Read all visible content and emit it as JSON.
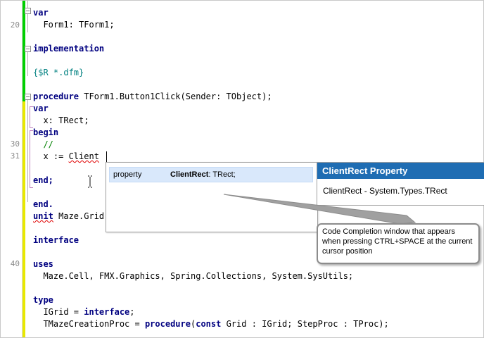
{
  "editor": {
    "line_numbers": [
      {
        "label": "20"
      },
      {
        "label": "30"
      },
      {
        "label": "31"
      },
      {
        "label": "40"
      }
    ],
    "lines": [
      {
        "text": "var"
      },
      {
        "text": "  Form1: TForm1;"
      },
      {
        "text": "implementation"
      },
      {
        "text": "{$R *.dfm}"
      },
      {
        "p1": "procedure",
        "p2": " TForm1.Button1Click(Sender: TObject);"
      },
      {
        "text": "var"
      },
      {
        "text": "  x: TRect;"
      },
      {
        "text": "begin"
      },
      {
        "text": "  //"
      },
      {
        "p1": "  x := ",
        "p2": "Client"
      },
      {
        "text": "end;"
      },
      {
        "text": "end."
      },
      {
        "p1": "unit",
        "p2": " Maze.Grid"
      },
      {
        "text": "interface"
      },
      {
        "text": "uses"
      },
      {
        "text": "  Maze.Cell, FMX.Graphics, Spring.Collections, System.SysUtils;"
      },
      {
        "text": "type"
      },
      {
        "p1": "  IGrid = ",
        "p2": "interface",
        "p3": ";"
      },
      {
        "p1": "  TMazeCreationProc = ",
        "p2": "procedure",
        "p3": "(",
        "p4": "const",
        "p5": " Grid : IGrid; StepProc : TProc);"
      }
    ]
  },
  "completion": {
    "kind": "property",
    "name": "ClientRect",
    "signature": ": TRect;"
  },
  "help": {
    "title": "ClientRect Property",
    "body": "ClientRect - System.Types.TRect"
  },
  "callout": {
    "text": "Code Completion window that appears when pressing CTRL+SPACE at the current cursor position"
  },
  "colors": {
    "keyword": "#000080",
    "directive": "#008080",
    "comment": "#008000",
    "help_header": "#1f6db3",
    "selection": "#d9e8fb",
    "change_saved": "#00d000",
    "change_modified": "#e8e800"
  }
}
